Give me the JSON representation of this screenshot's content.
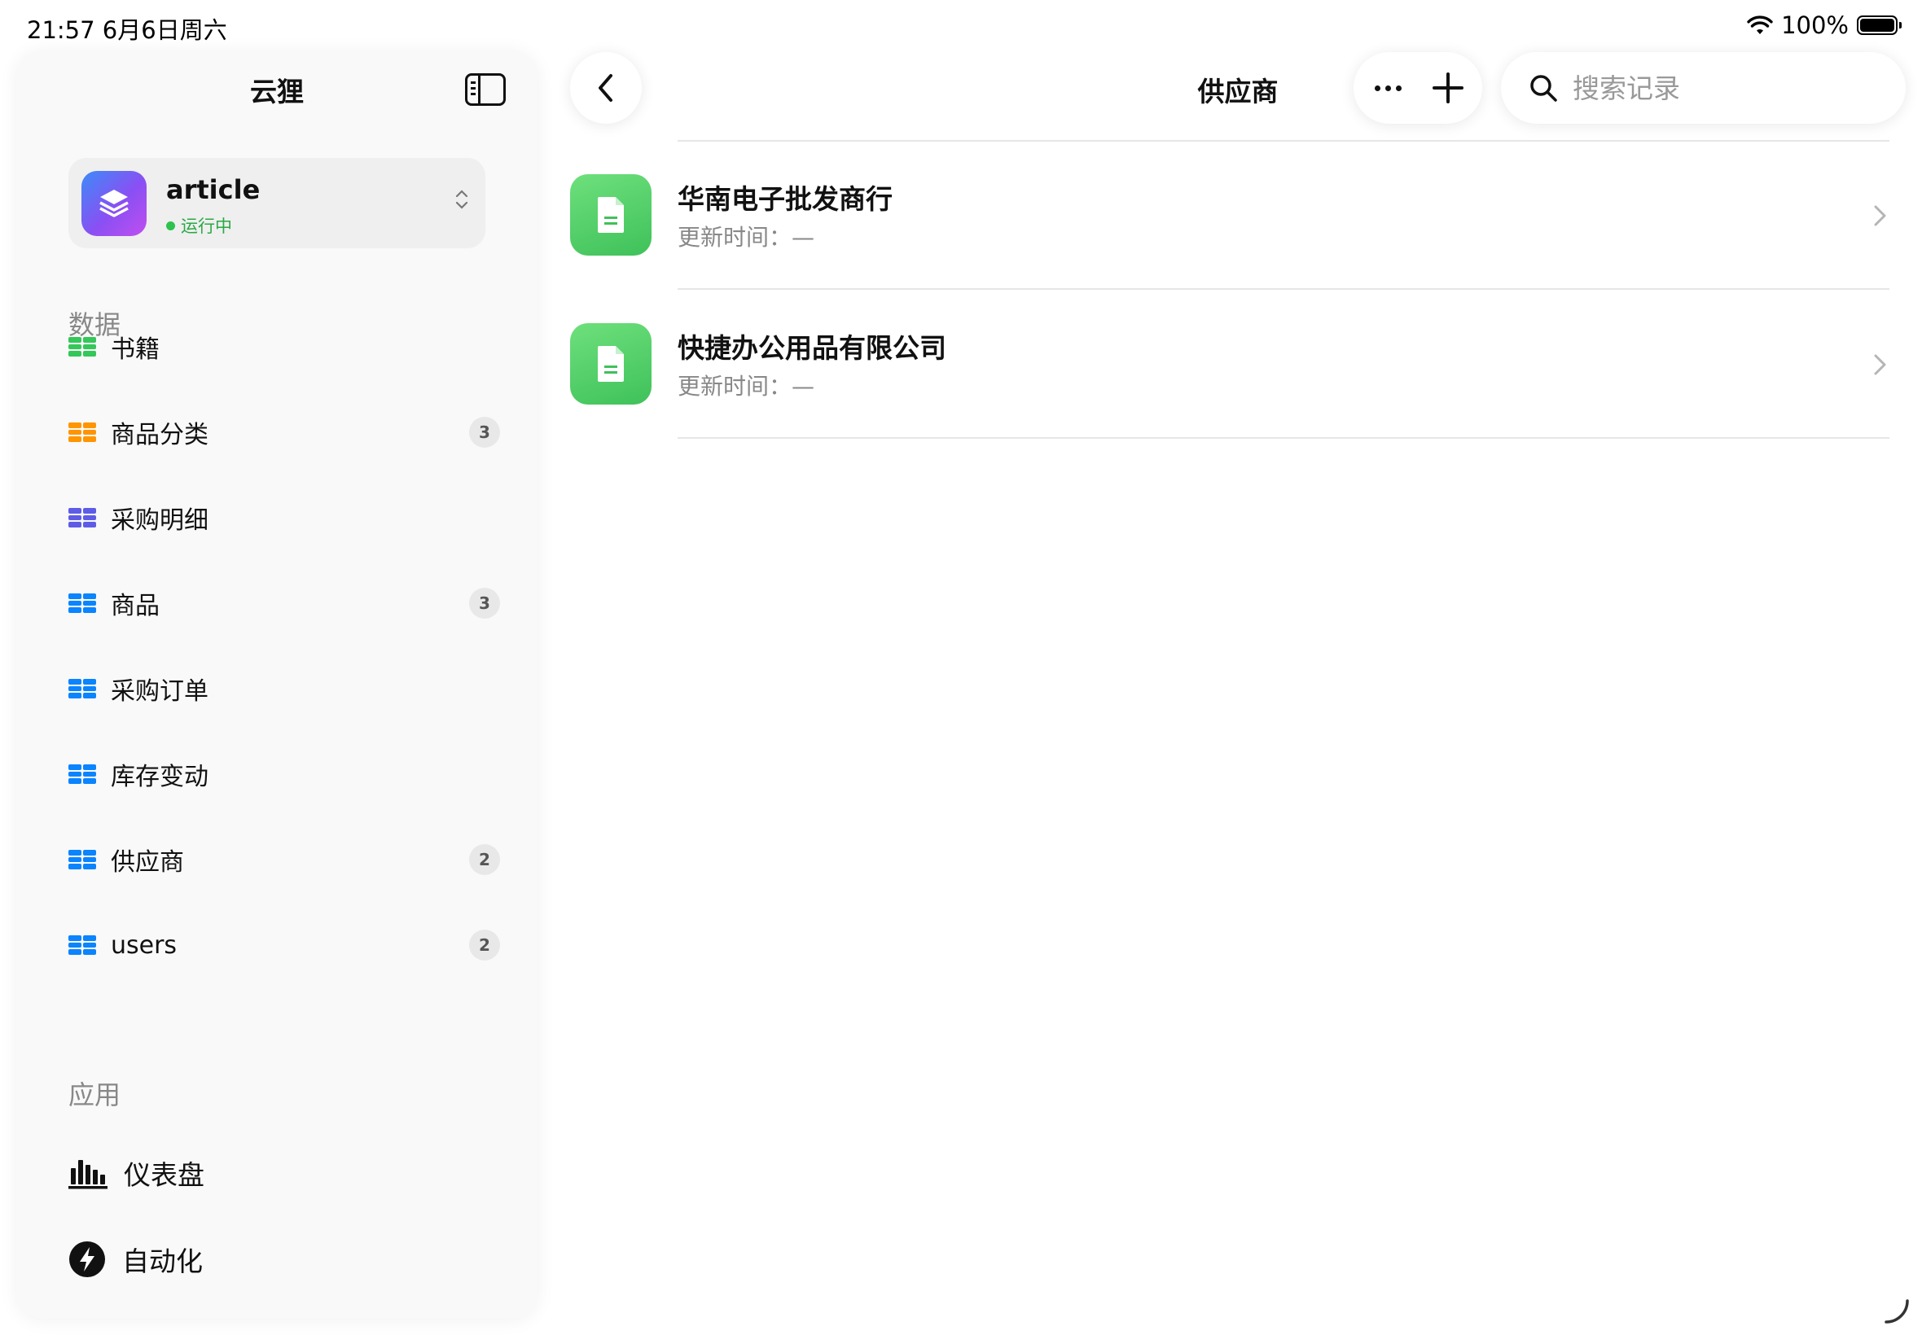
{
  "status_bar": {
    "time_date": "21:57  6月6日周六",
    "battery_text": "100%"
  },
  "sidebar": {
    "app_title": "云狸",
    "database": {
      "name": "article",
      "status": "运行中"
    },
    "sections": {
      "data_label": "数据",
      "apps_label": "应用"
    },
    "tables": [
      {
        "label": "书籍",
        "badge": "",
        "color": "#34c759"
      },
      {
        "label": "商品分类",
        "badge": "3",
        "color": "#ff9500"
      },
      {
        "label": "采购明细",
        "badge": "",
        "color": "#5e5ce6"
      },
      {
        "label": "商品",
        "badge": "3",
        "color": "#0a84ff"
      },
      {
        "label": "采购订单",
        "badge": "",
        "color": "#0a84ff"
      },
      {
        "label": "库存变动",
        "badge": "",
        "color": "#0a84ff"
      },
      {
        "label": "供应商",
        "badge": "2",
        "color": "#0a84ff"
      },
      {
        "label": "users",
        "badge": "2",
        "color": "#0a84ff"
      }
    ],
    "apps": [
      {
        "label": "仪表盘",
        "icon": "bar-chart-icon"
      },
      {
        "label": "自动化",
        "icon": "bolt-icon"
      }
    ]
  },
  "toolbar": {
    "title": "供应商",
    "search": {
      "placeholder": "搜索记录",
      "value": ""
    }
  },
  "records": [
    {
      "title": "华南电子批发商行",
      "subtitle": "更新时间：—"
    },
    {
      "title": "快捷办公用品有限公司",
      "subtitle": "更新时间：—"
    }
  ],
  "colors": {
    "accent_green": "#34c759",
    "status_green": "#2aa845",
    "badge_bg": "#e8e8e8"
  }
}
